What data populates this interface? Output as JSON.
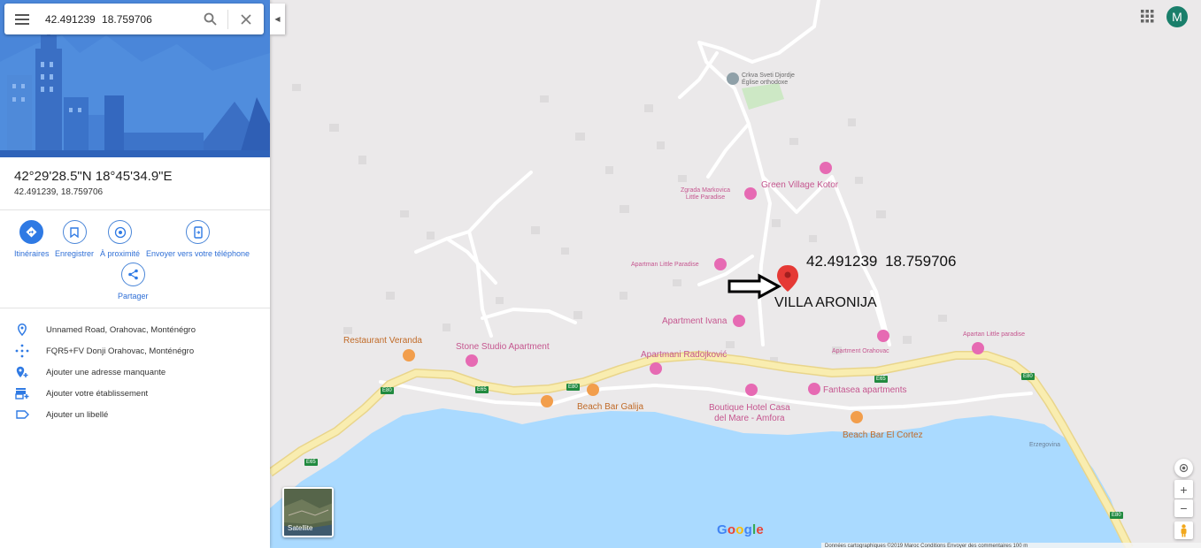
{
  "search": {
    "query": "42.491239  18.759706"
  },
  "place": {
    "dms": "42°29'28.5\"N 18°45'34.9\"E",
    "decimal": "42.491239, 18.759706"
  },
  "actions": {
    "directions": "Itinéraires",
    "save": "Enregistrer",
    "nearby": "À proximité",
    "send_to_phone": "Envoyer vers votre téléphone",
    "share": "Partager"
  },
  "info": {
    "address": "Unnamed Road, Orahovac, Monténégro",
    "plus_code": "FQR5+FV Donji Orahovac, Monténégro",
    "add_address": "Ajouter une adresse manquante",
    "add_business": "Ajouter votre établissement",
    "add_label": "Ajouter un libellé"
  },
  "map": {
    "church_1": "Crkva Sveti Djordje",
    "church_2": "Église orthodoxe",
    "green_village": "Green Village Kotor",
    "zgrada_1": "Zgrada Markovica",
    "zgrada_2": "Little Paradise",
    "apartman_lp": "Apartman Little Paradise",
    "apartment_ivana": "Apartment Ivana",
    "restaurant_veranda": "Restaurant Veranda",
    "stone_studio": "Stone Studio Apartment",
    "apartmani_radojkovic": "Apartmani Radojković",
    "apartment_orahovac": "Apartment Orahovac",
    "apartan_lp": "Apartan Little paradise",
    "fantasea": "Fantasea apartments",
    "beach_galija": "Beach Bar Galija",
    "boutique_1": "Boutique Hotel Casa",
    "boutique_2": "del Mare - Amfora",
    "beach_cortez": "Beach Bar El Cortez",
    "erzegovina": "Erzegovina",
    "road_e80": "E80",
    "road_e65": "E65",
    "annot_coords": "42.491239  18.759706",
    "annot_villa": "VILLA ARONIJA"
  },
  "controls": {
    "avatar_letter": "M",
    "satellite": "Satellite",
    "google": [
      "G",
      "o",
      "o",
      "g",
      "l",
      "e"
    ]
  },
  "footer": "Données cartographiques ©2019   Maroc   Conditions   Envoyer des commentaires   100 m"
}
